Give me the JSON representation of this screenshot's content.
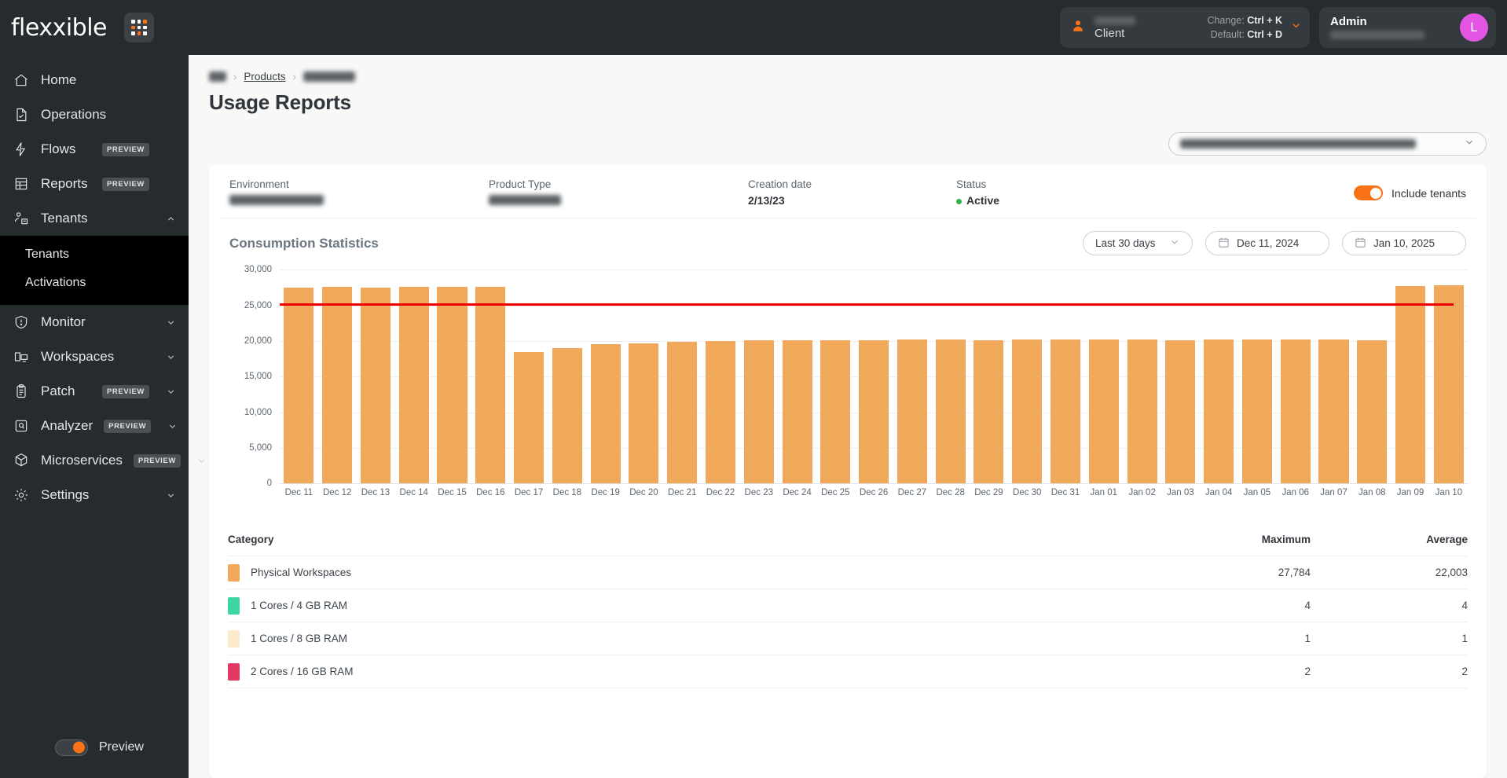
{
  "brand": {
    "name": "flexxible",
    "grid_icon": "apps-grid-icon"
  },
  "topbar": {
    "client": {
      "icon": "person-icon",
      "name_redacted": "",
      "role_label": "Client",
      "change_label": "Change:",
      "change_key": "Ctrl + K",
      "default_label": "Default:",
      "default_key": "Ctrl + D",
      "caret_icon": "chevron-down-icon"
    },
    "admin": {
      "title": "Admin",
      "name_redacted": "",
      "avatar_initial": "L",
      "avatar_color": "#e455e4"
    }
  },
  "sidebar": {
    "items": [
      {
        "label": "Home",
        "icon": "home-icon",
        "badge": "",
        "expandable": false
      },
      {
        "label": "Operations",
        "icon": "document-check-icon",
        "badge": "",
        "expandable": false
      },
      {
        "label": "Flows",
        "icon": "flow-bolt-icon",
        "badge": "PREVIEW",
        "expandable": false
      },
      {
        "label": "Reports",
        "icon": "table-report-icon",
        "badge": "PREVIEW",
        "expandable": false
      },
      {
        "label": "Tenants",
        "icon": "tenants-people-icon",
        "badge": "",
        "expandable": true,
        "expanded": true
      },
      {
        "label": "Monitor",
        "icon": "shield-alert-icon",
        "badge": "",
        "expandable": true
      },
      {
        "label": "Workspaces",
        "icon": "workspace-desktop-icon",
        "badge": "",
        "expandable": true
      },
      {
        "label": "Patch",
        "icon": "clipboard-list-icon",
        "badge": "PREVIEW",
        "expandable": true
      },
      {
        "label": "Analyzer",
        "icon": "analyzer-scan-icon",
        "badge": "PREVIEW",
        "expandable": true
      },
      {
        "label": "Microservices",
        "icon": "cube-icon",
        "badge": "PREVIEW",
        "expandable": true
      },
      {
        "label": "Settings",
        "icon": "gear-icon",
        "badge": "",
        "expandable": true
      }
    ],
    "submenu": [
      {
        "label": "Tenants"
      },
      {
        "label": "Activations"
      }
    ],
    "footer": {
      "toggle_label": "Preview",
      "toggle_on": true
    }
  },
  "breadcrumb": {
    "item1_redacted": "",
    "products": "Products",
    "item3_redacted": "",
    "separator": "›"
  },
  "page": {
    "title": "Usage Reports"
  },
  "product_select": {
    "value_redacted": "",
    "caret_icon": "chevron-down-icon"
  },
  "info": {
    "environment_label": "Environment",
    "environment_value_redacted": "",
    "product_type_label": "Product Type",
    "product_type_value_redacted": "",
    "creation_date_label": "Creation date",
    "creation_date_value": "2/13/23",
    "status_label": "Status",
    "status_value": "Active",
    "status_color": "#2fb344",
    "include_tenants_label": "Include tenants",
    "include_tenants_on": true,
    "toggle_color": "#f97316"
  },
  "chart_section": {
    "title": "Consumption Statistics",
    "range_select": {
      "value": "Last 30 days",
      "caret_icon": "chevron-down-icon"
    },
    "date_from": {
      "value": "Dec 11, 2024",
      "icon": "calendar-icon"
    },
    "date_to": {
      "value": "Jan 10, 2025",
      "icon": "calendar-icon"
    }
  },
  "chart_data": {
    "type": "bar",
    "title": "Consumption Statistics",
    "xlabel": "",
    "ylabel": "",
    "ylim": [
      0,
      30000
    ],
    "yticks": [
      0,
      5000,
      10000,
      15000,
      20000,
      25000,
      30000
    ],
    "ytick_labels": [
      "0",
      "5,000",
      "10,000",
      "15,000",
      "20,000",
      "25,000",
      "30,000"
    ],
    "grid": true,
    "legend": false,
    "bar_color": "#f0a85a",
    "threshold": {
      "value": 25000,
      "color": "#ef0000",
      "label": ""
    },
    "categories": [
      "Dec 11",
      "Dec 12",
      "Dec 13",
      "Dec 14",
      "Dec 15",
      "Dec 16",
      "Dec 17",
      "Dec 18",
      "Dec 19",
      "Dec 20",
      "Dec 21",
      "Dec 22",
      "Dec 23",
      "Dec 24",
      "Dec 25",
      "Dec 26",
      "Dec 27",
      "Dec 28",
      "Dec 29",
      "Dec 30",
      "Dec 31",
      "Jan 01",
      "Jan 02",
      "Jan 03",
      "Jan 04",
      "Jan 05",
      "Jan 06",
      "Jan 07",
      "Jan 08",
      "Jan 09",
      "Jan 10"
    ],
    "values": [
      27500,
      27550,
      27500,
      27600,
      27550,
      27600,
      18400,
      19000,
      19500,
      19700,
      19900,
      20000,
      20050,
      20100,
      20150,
      20150,
      20200,
      20200,
      20150,
      20200,
      20200,
      20200,
      20200,
      20150,
      20200,
      20200,
      20200,
      20200,
      20150,
      27700,
      27784
    ]
  },
  "table": {
    "columns": {
      "category": "Category",
      "maximum": "Maximum",
      "average": "Average"
    },
    "rows": [
      {
        "color": "#f0a85a",
        "category": "Physical Workspaces",
        "maximum": "27,784",
        "average": "22,003"
      },
      {
        "color": "#3dd6a0",
        "category": "1 Cores / 4 GB RAM",
        "maximum": "4",
        "average": "4"
      },
      {
        "color": "#fce8cb",
        "category": "1 Cores / 8 GB RAM",
        "maximum": "1",
        "average": "1"
      },
      {
        "color": "#e03a63",
        "category": "2 Cores / 16 GB RAM",
        "maximum": "2",
        "average": "2"
      }
    ]
  }
}
